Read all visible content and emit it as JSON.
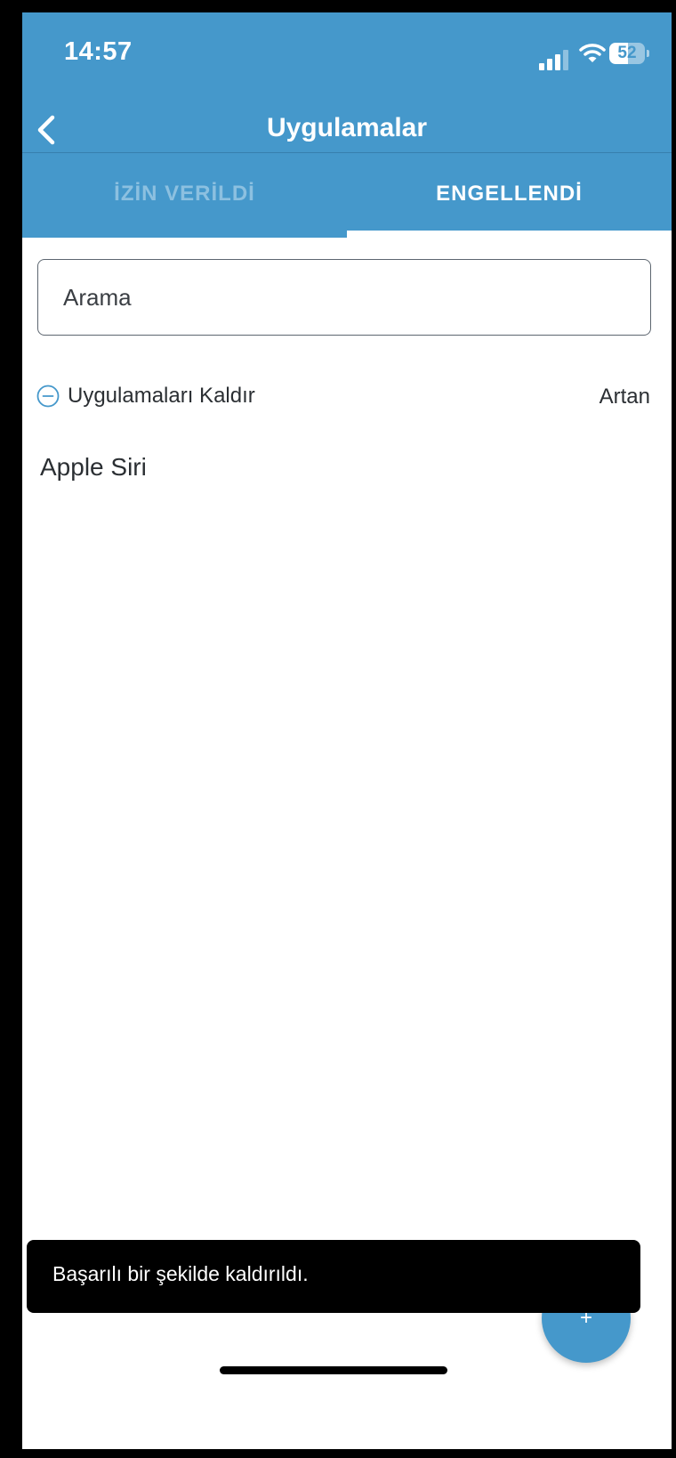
{
  "status_bar": {
    "time": "14:57",
    "battery_level": "52",
    "signal_icon": "cellular-signal-icon",
    "wifi_icon": "wifi-icon",
    "battery_icon": "battery-icon"
  },
  "header": {
    "title": "Uygulamalar",
    "back_icon": "chevron-left-icon",
    "background_color": "#4598cb"
  },
  "tabs": [
    {
      "label": "İZİN VERİLDİ",
      "active": false
    },
    {
      "label": "ENGELLENDİ",
      "active": true
    }
  ],
  "search": {
    "placeholder": "Arama",
    "value": ""
  },
  "actions": {
    "remove_label": "Uygulamaları Kaldır",
    "remove_icon": "minus-circle-icon",
    "sort_label": "Artan"
  },
  "apps": [
    {
      "name": "Apple Siri"
    }
  ],
  "fab": {
    "label": "+",
    "icon": "plus-icon"
  },
  "snackbar": {
    "message": "Başarılı bir şekilde kaldırıldı."
  }
}
